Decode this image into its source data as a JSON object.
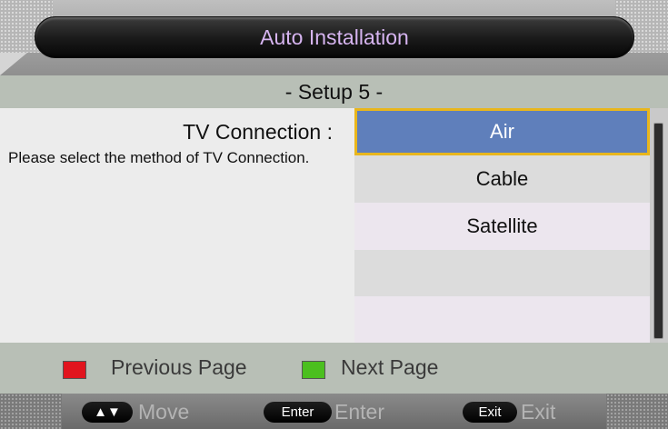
{
  "header": {
    "title": "Auto Installation",
    "step": "- Setup 5 -"
  },
  "setting": {
    "label": "TV Connection :",
    "help": "Please select the method of TV Connection."
  },
  "options": [
    {
      "label": "Air",
      "selected": true
    },
    {
      "label": "Cable",
      "selected": false
    },
    {
      "label": "Satellite",
      "selected": false
    },
    {
      "label": "",
      "selected": false
    },
    {
      "label": "",
      "selected": false
    }
  ],
  "color_keys": {
    "previous": {
      "label": "Previous Page",
      "color": "#e1141e"
    },
    "next": {
      "label": "Next Page",
      "color": "#4bbf1f"
    }
  },
  "nav_hints": {
    "move": {
      "key": "▲▼",
      "label": "Move"
    },
    "enter": {
      "key": "Enter",
      "label": "Enter"
    },
    "exit": {
      "key": "Exit",
      "label": "Exit"
    }
  },
  "colors": {
    "title_text": "#d6b4f0",
    "selected_bg": "#5f7fbb",
    "selected_border": "#e8b61d"
  }
}
